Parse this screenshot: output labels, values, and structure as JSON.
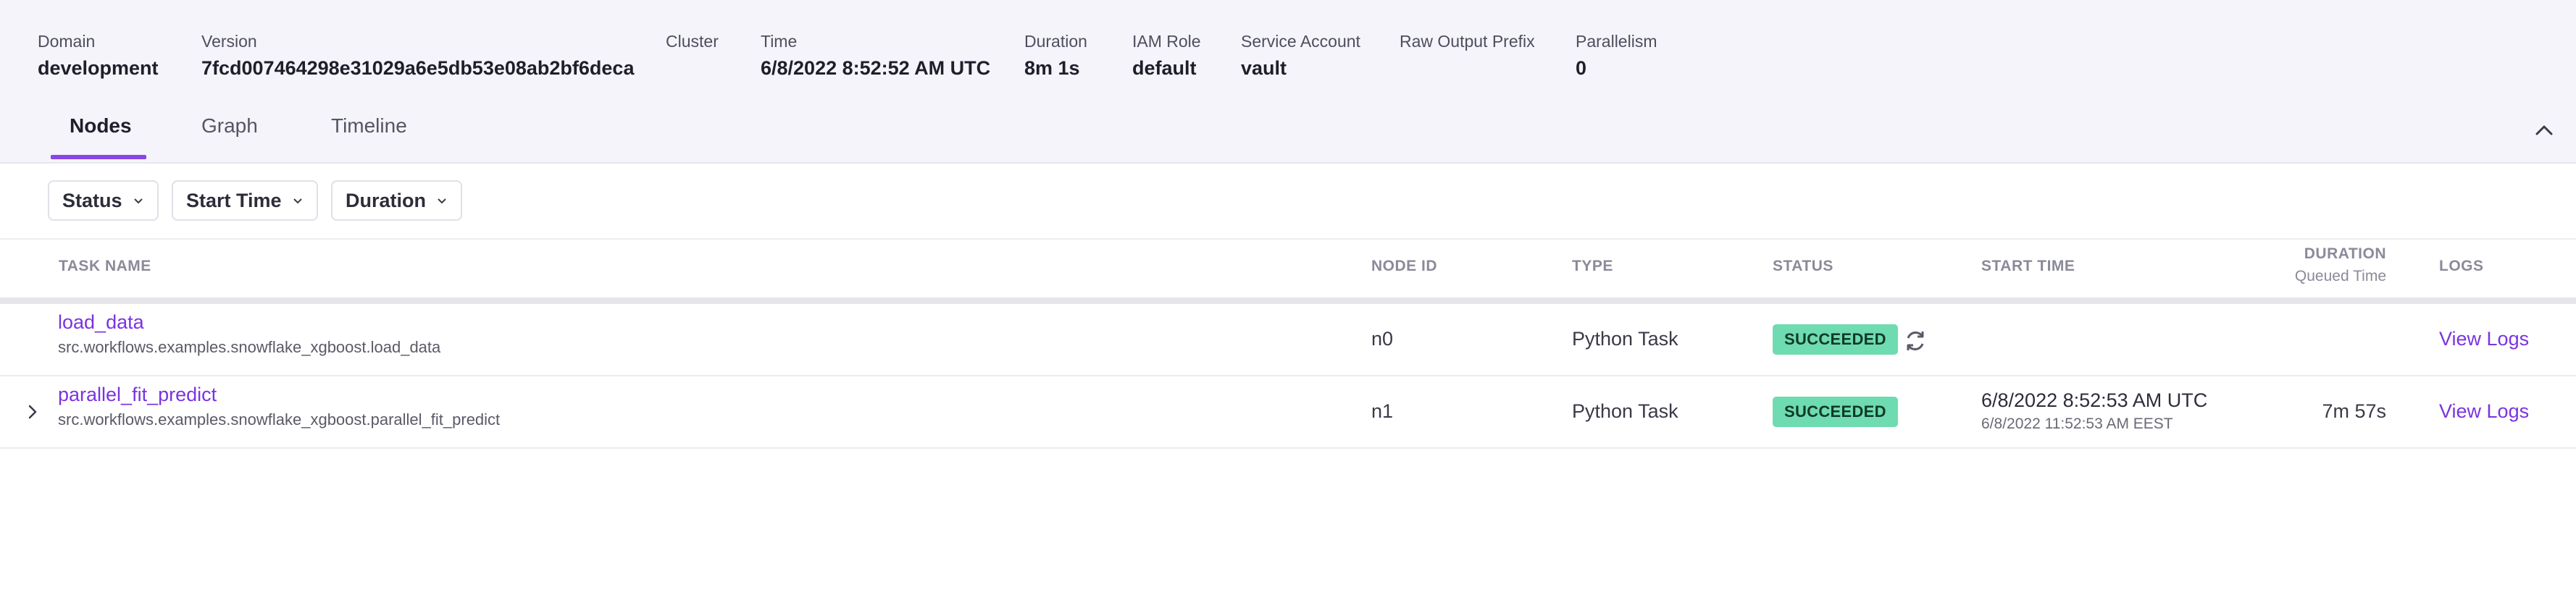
{
  "meta": [
    {
      "label": "Domain",
      "value": "development"
    },
    {
      "label": "Version",
      "value": "7fcd007464298e31029a6e5db53e08ab2bf6deca"
    },
    {
      "label": "Cluster",
      "value": ""
    },
    {
      "label": "Time",
      "value": "6/8/2022 8:52:52 AM UTC"
    },
    {
      "label": "Duration",
      "value": "8m 1s"
    },
    {
      "label": "IAM Role",
      "value": "default"
    },
    {
      "label": "Service Account",
      "value": "vault"
    },
    {
      "label": "Raw Output Prefix",
      "value": ""
    },
    {
      "label": "Parallelism",
      "value": "0"
    }
  ],
  "tabs": [
    {
      "label": "Nodes",
      "active": true
    },
    {
      "label": "Graph",
      "active": false
    },
    {
      "label": "Timeline",
      "active": false
    }
  ],
  "filters": [
    {
      "label": "Status"
    },
    {
      "label": "Start Time"
    },
    {
      "label": "Duration"
    }
  ],
  "columns": {
    "task_name": "TASK NAME",
    "node_id": "NODE ID",
    "type": "TYPE",
    "status": "STATUS",
    "start_time": "START TIME",
    "duration": "DURATION",
    "duration_sub": "Queued Time",
    "logs": "LOGS"
  },
  "rows": [
    {
      "name": "load_data",
      "path": "src.workflows.examples.snowflake_xgboost.load_data",
      "node_id": "n0",
      "type": "Python Task",
      "status": "SUCCEEDED",
      "cache_icon": "refresh-icon",
      "start_time": "",
      "start_time_local": "",
      "duration": "",
      "logs": "View Logs",
      "expandable": false
    },
    {
      "name": "parallel_fit_predict",
      "path": "src.workflows.examples.snowflake_xgboost.parallel_fit_predict",
      "node_id": "n1",
      "type": "Python Task",
      "status": "SUCCEEDED",
      "start_time": "6/8/2022 8:52:53 AM UTC",
      "start_time_local": "6/8/2022 11:52:53 AM EEST",
      "duration": "7m 57s",
      "logs": "View Logs",
      "expandable": true
    }
  ],
  "colors": {
    "accent": "#8a45e6",
    "link": "#7a34e0",
    "success_badge": "#6fdbb0",
    "header_bg": "#f4f4fa"
  }
}
